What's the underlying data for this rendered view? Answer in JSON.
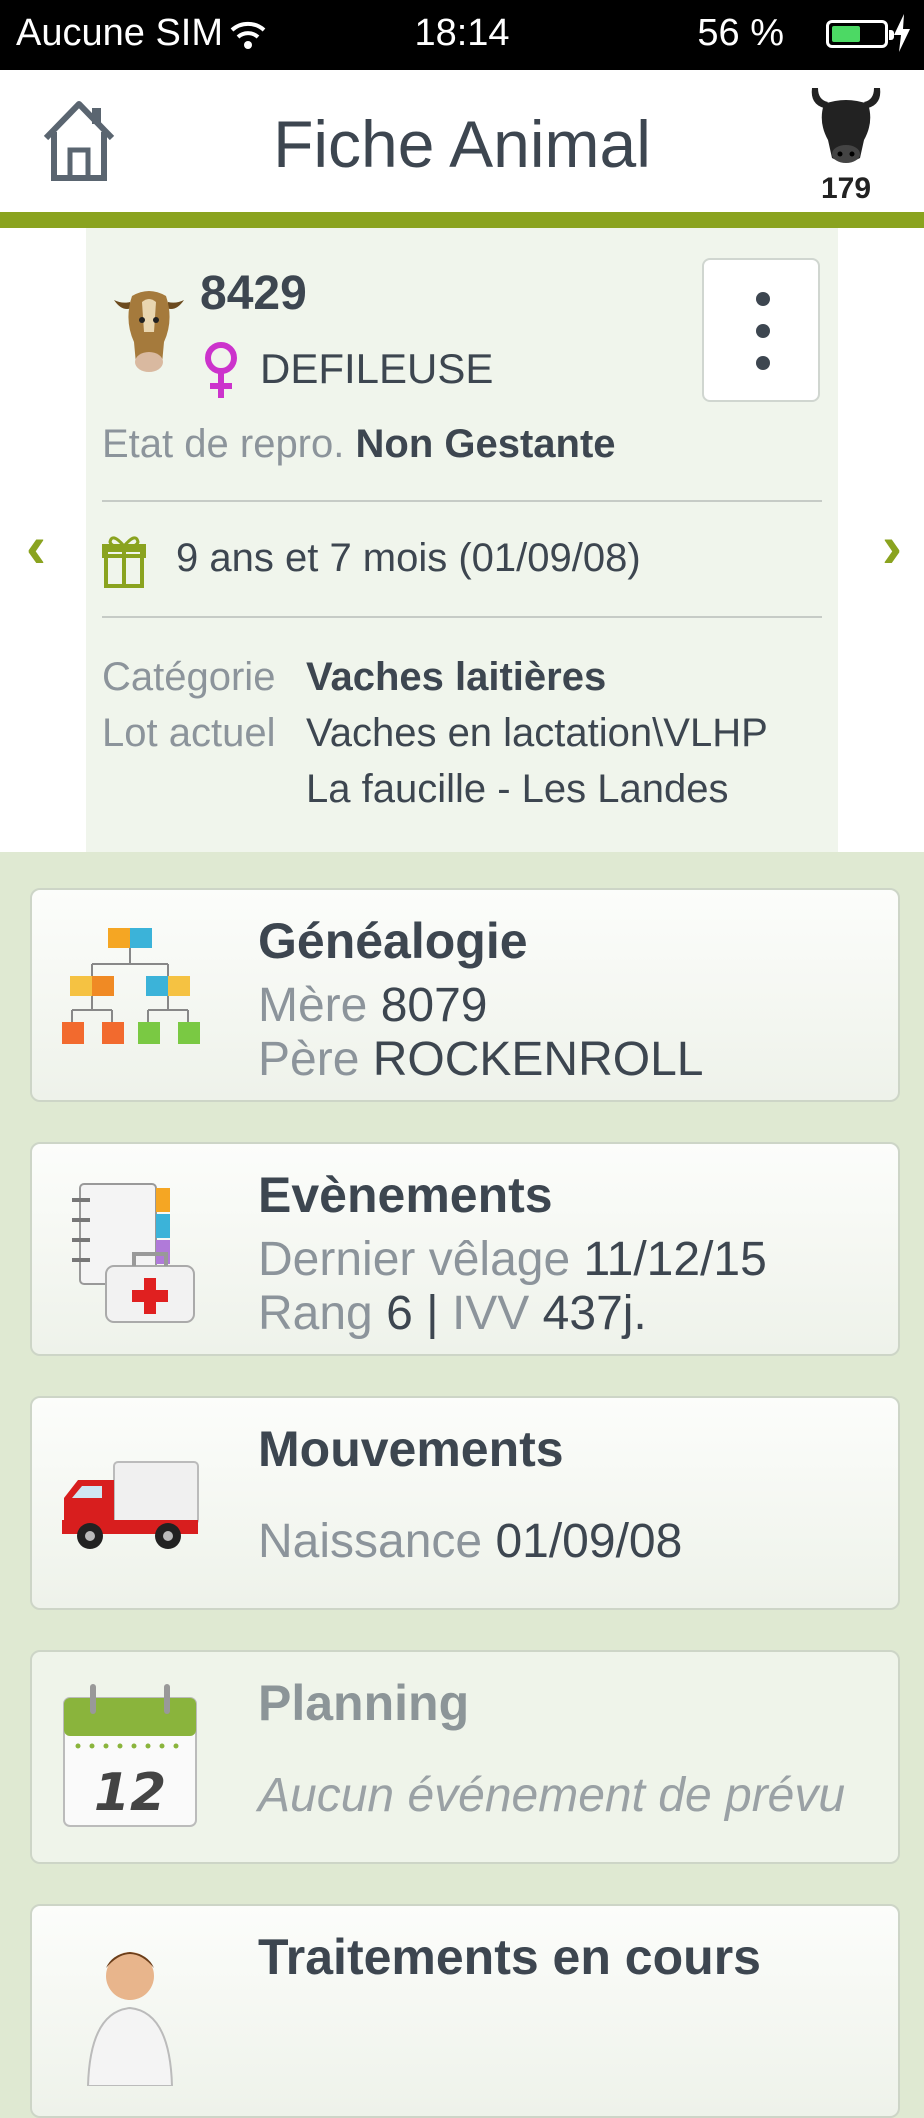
{
  "status_bar": {
    "carrier": "Aucune SIM",
    "time": "18:14",
    "battery_percent_label": "56 %",
    "battery_level": 0.56
  },
  "header": {
    "title": "Fiche Animal",
    "herd_count": "179"
  },
  "animal": {
    "id": "8429",
    "name": "DEFILEUSE",
    "repro_label": "Etat de repro.",
    "repro_value": "Non Gestante",
    "age": "9 ans et 7 mois (01/09/08)",
    "category_label": "Catégorie",
    "category_value": "Vaches laitières",
    "lot_label": "Lot actuel",
    "lot_value_1": "Vaches en lactation\\VLHP",
    "lot_value_2": "La faucille - Les Landes"
  },
  "nav": {
    "prev": "‹",
    "next": "›"
  },
  "cards": {
    "genealogy": {
      "title": "Généalogie",
      "mother_label": "Mère",
      "mother_value": "8079",
      "father_label": "Père",
      "father_value": "ROCKENROLL"
    },
    "events": {
      "title": "Evènements",
      "last_calving_label": "Dernier vêlage",
      "last_calving_value": "11/12/15",
      "rank_label": "Rang",
      "rank_value": "6",
      "separator": "|",
      "ivv_label": "IVV",
      "ivv_value": "437j."
    },
    "movements": {
      "title": "Mouvements",
      "birth_label": "Naissance",
      "birth_value": "01/09/08"
    },
    "planning": {
      "title": "Planning",
      "empty_text": "Aucun événement de prévu",
      "calendar_day": "12"
    },
    "treatments": {
      "title": "Traitements en cours"
    }
  },
  "colors": {
    "accent_green": "#8aa31f",
    "female_pink": "#cc33cc",
    "background": "#dfe9d2"
  },
  "icons": [
    "home-icon",
    "cow-head-icon",
    "female-icon",
    "gift-icon",
    "genealogy-icon",
    "events-icon",
    "truck-icon",
    "calendar-icon",
    "vet-icon"
  ]
}
